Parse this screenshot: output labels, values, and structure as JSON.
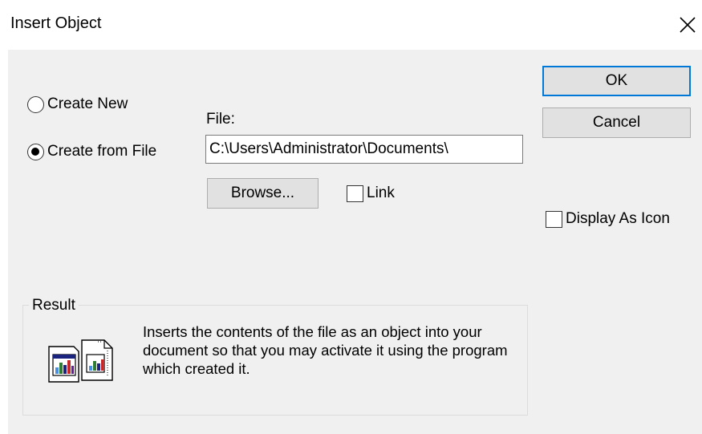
{
  "dialog": {
    "title": "Insert Object",
    "close_icon": "close-icon"
  },
  "options": {
    "create_new_label": "Create New",
    "create_from_file_label": "Create from File",
    "selected": "Create from File"
  },
  "file": {
    "label": "File:",
    "value": "C:\\Users\\Administrator\\Documents\\"
  },
  "buttons": {
    "ok_label": "OK",
    "cancel_label": "Cancel",
    "browse_label": "Browse..."
  },
  "checkboxes": {
    "link_label": "Link",
    "link_checked": false,
    "display_as_icon_label": "Display As Icon",
    "display_as_icon_checked": false
  },
  "result": {
    "legend": "Result",
    "icon": "insert-file-object-icon",
    "text": "Inserts the contents of the file as an object into your document so that you may activate it using the program which created it."
  },
  "colors": {
    "dialog_background": "#f0f0f0",
    "button_face": "#e1e1e1",
    "default_button_border": "#0078d7"
  }
}
